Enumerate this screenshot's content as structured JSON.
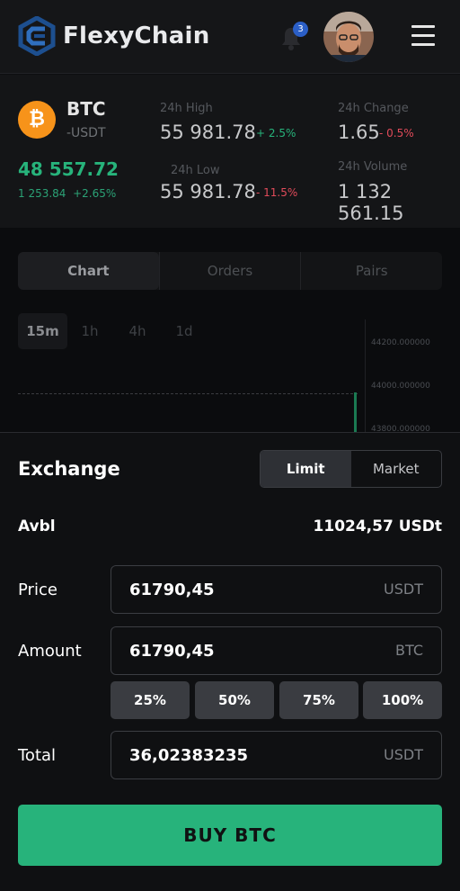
{
  "header": {
    "app_name": "FlexyChain",
    "notification_count": "3",
    "logo_icon": "flexychain-logo-icon",
    "bell_icon": "bell-icon",
    "menu_icon": "hamburger-menu-icon"
  },
  "ticker": {
    "coin_icon": "bitcoin-icon",
    "symbol": "BTC",
    "pair": "-USDT",
    "last_price": "48 557.72",
    "last_price_sub": "1 253.84",
    "last_price_change": "+2.65%",
    "high_label": "24h High",
    "high_value": "55 981.78",
    "high_change": "+ 2.5%",
    "low_label": "24h Low",
    "low_value": "55 981.78",
    "low_change": "- 11.5%",
    "change_label": "24h Change",
    "change_value": "1.65",
    "change_change": "- 0.5%",
    "volume_label": "24h Volume",
    "volume_value": "1 132 561.15"
  },
  "chart_tabs": [
    "Chart",
    "Orders",
    "Pairs"
  ],
  "timeframes": [
    "15m",
    "1h",
    "4h",
    "1d"
  ],
  "chart_axis": [
    "44200.000000",
    "44000.000000",
    "43800.000000"
  ],
  "exchange": {
    "title": "Exchange",
    "mode_limit": "Limit",
    "mode_market": "Market",
    "avbl_label": "Avbl",
    "avbl_value": "11024,57 USDt",
    "price_label": "Price",
    "price_value": "61790,45",
    "price_unit": "USDT",
    "amount_label": "Amount",
    "amount_value": "61790,45",
    "amount_unit": "BTC",
    "percents": [
      "25%",
      "50%",
      "75%",
      "100%"
    ],
    "total_label": "Total",
    "total_value": "36,02383235",
    "total_unit": "USDT",
    "buy_label": "BUY BTC"
  },
  "colors": {
    "accent_green": "#27b37b",
    "negative_red": "#e14b5a",
    "btc_orange": "#f7931a",
    "badge_blue": "#2b5fc7"
  }
}
